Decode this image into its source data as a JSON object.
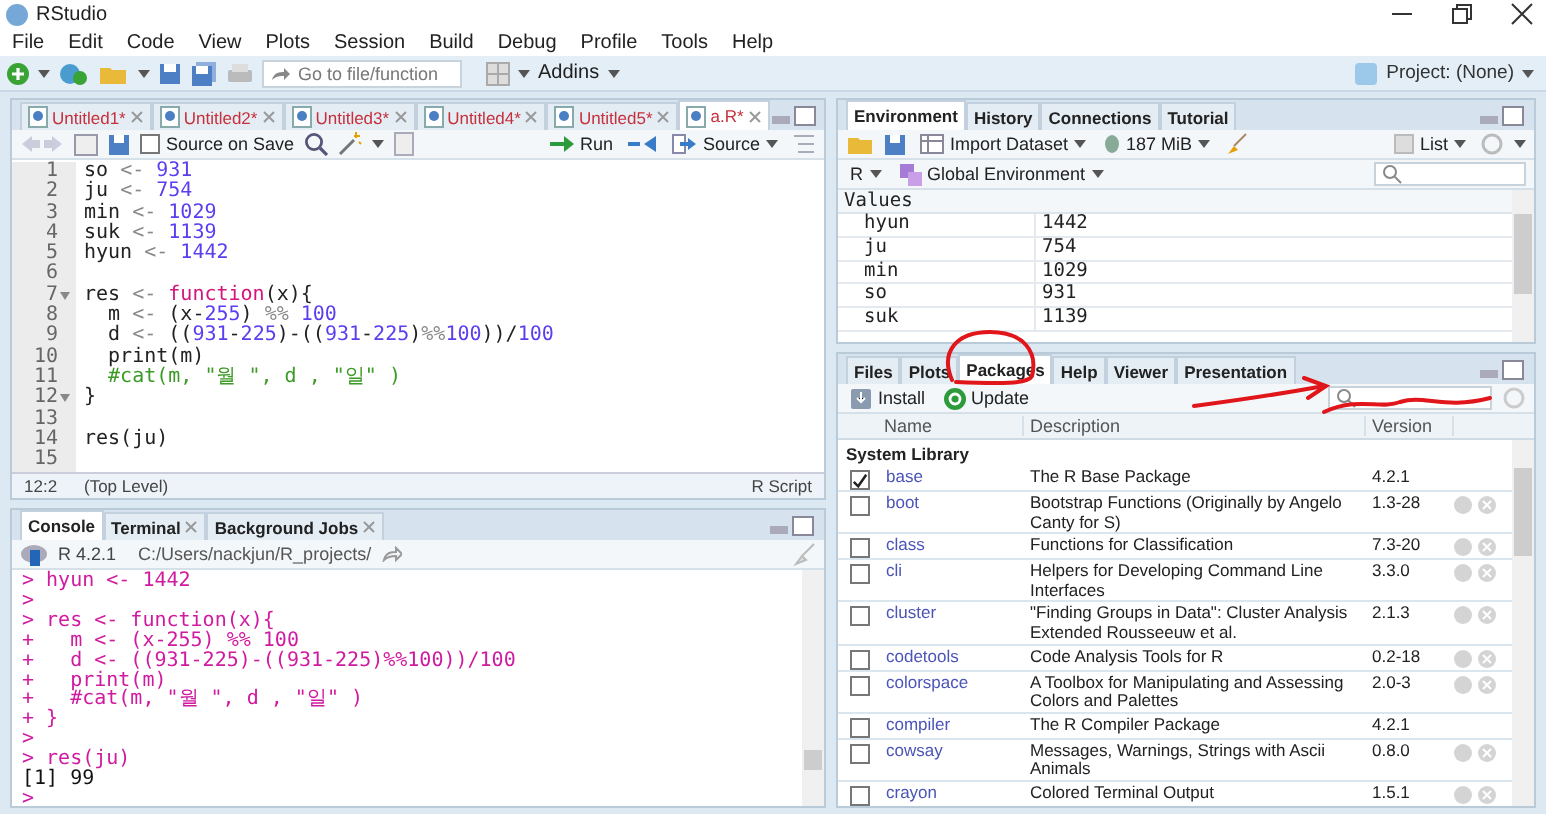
{
  "window": {
    "title": "RStudio"
  },
  "menu": [
    "File",
    "Edit",
    "Code",
    "View",
    "Plots",
    "Session",
    "Build",
    "Debug",
    "Profile",
    "Tools",
    "Help"
  ],
  "toolbar": {
    "goto_placeholder": "Go to file/function",
    "addins": "Addins",
    "project": "Project: (None)"
  },
  "editor": {
    "tabs": [
      {
        "label": "Untitled1*",
        "selected": false,
        "modified": true
      },
      {
        "label": "Untitled2*",
        "selected": false,
        "modified": true
      },
      {
        "label": "Untitled3*",
        "selected": false,
        "modified": true
      },
      {
        "label": "Untitled4*",
        "selected": false,
        "modified": true
      },
      {
        "label": "Untitled5*",
        "selected": false,
        "modified": true
      },
      {
        "label": "a.R*",
        "selected": true,
        "modified": true
      }
    ],
    "source_on_save": {
      "label": "Source on Save",
      "checked": false
    },
    "run": "Run",
    "source": "Source",
    "lines": [
      {
        "number": "1",
        "fold": false,
        "tokens": [
          {
            "kind": "plain",
            "text": "so "
          },
          {
            "kind": "op",
            "text": "<- "
          },
          {
            "kind": "number",
            "text": "931"
          }
        ]
      },
      {
        "number": "2",
        "fold": false,
        "tokens": [
          {
            "kind": "plain",
            "text": "ju "
          },
          {
            "kind": "op",
            "text": "<- "
          },
          {
            "kind": "number",
            "text": "754"
          }
        ]
      },
      {
        "number": "3",
        "fold": false,
        "tokens": [
          {
            "kind": "plain",
            "text": "min "
          },
          {
            "kind": "op",
            "text": "<- "
          },
          {
            "kind": "number",
            "text": "1029"
          }
        ]
      },
      {
        "number": "4",
        "fold": false,
        "tokens": [
          {
            "kind": "plain",
            "text": "suk "
          },
          {
            "kind": "op",
            "text": "<- "
          },
          {
            "kind": "number",
            "text": "1139"
          }
        ]
      },
      {
        "number": "5",
        "fold": false,
        "tokens": [
          {
            "kind": "plain",
            "text": "hyun "
          },
          {
            "kind": "op",
            "text": "<- "
          },
          {
            "kind": "number",
            "text": "1442"
          }
        ]
      },
      {
        "number": "6",
        "fold": false
      },
      {
        "number": "7",
        "fold": true,
        "tokens": [
          {
            "kind": "plain",
            "text": "res "
          },
          {
            "kind": "op",
            "text": "<- "
          },
          {
            "kind": "keyword",
            "text": "function"
          },
          {
            "kind": "plain",
            "text": "(x){"
          }
        ]
      },
      {
        "number": "8",
        "fold": false,
        "tokens": [
          {
            "kind": "plain",
            "text": "  m "
          },
          {
            "kind": "op",
            "text": "<- "
          },
          {
            "kind": "plain",
            "text": "(x-"
          },
          {
            "kind": "number",
            "text": "255"
          },
          {
            "kind": "plain",
            "text": ") "
          },
          {
            "kind": "op",
            "text": "%% "
          },
          {
            "kind": "number",
            "text": "100"
          }
        ]
      },
      {
        "number": "9",
        "fold": false,
        "tokens": [
          {
            "kind": "plain",
            "text": "  d "
          },
          {
            "kind": "op",
            "text": "<- "
          },
          {
            "kind": "plain",
            "text": "(("
          },
          {
            "kind": "number",
            "text": "931"
          },
          {
            "kind": "plain",
            "text": "-"
          },
          {
            "kind": "number",
            "text": "225"
          },
          {
            "kind": "plain",
            "text": ")-(("
          },
          {
            "kind": "number",
            "text": "931"
          },
          {
            "kind": "plain",
            "text": "-"
          },
          {
            "kind": "number",
            "text": "225"
          },
          {
            "kind": "plain",
            "text": ")"
          },
          {
            "kind": "op",
            "text": "%%"
          },
          {
            "kind": "number",
            "text": "100"
          },
          {
            "kind": "plain",
            "text": "))/"
          },
          {
            "kind": "number",
            "text": "100"
          }
        ]
      },
      {
        "number": "10",
        "fold": false,
        "tokens": [
          {
            "kind": "plain",
            "text": "  print(m)"
          }
        ]
      },
      {
        "number": "11",
        "fold": false,
        "tokens": [
          {
            "kind": "comment",
            "text": "  #cat(m, \"월 \", d , \"일\" )"
          }
        ]
      },
      {
        "number": "12",
        "fold": true,
        "tokens": [
          {
            "kind": "plain",
            "text": "}"
          }
        ]
      },
      {
        "number": "13",
        "fold": false
      },
      {
        "number": "14",
        "fold": false,
        "tokens": [
          {
            "kind": "plain",
            "text": "res(ju)"
          }
        ]
      },
      {
        "number": "15",
        "fold": false
      }
    ],
    "status": {
      "position": "12:2",
      "scope": "(Top Level)",
      "type": "R Script"
    }
  },
  "console": {
    "tabs": [
      {
        "label": "Console",
        "selected": true,
        "closable": false
      },
      {
        "label": "Terminal",
        "selected": false,
        "closable": true
      },
      {
        "label": "Background Jobs",
        "selected": false,
        "closable": true
      }
    ],
    "version": "R 4.2.1",
    "path": "C:/Users/nackjun/R_projects/",
    "lines": [
      {
        "kind": "input",
        "text": "> hyun <- 1442"
      },
      {
        "kind": "input",
        "text": ">"
      },
      {
        "kind": "input",
        "text": "> res <- function(x){"
      },
      {
        "kind": "input",
        "text": "+   m <- (x-255) %% 100"
      },
      {
        "kind": "input",
        "text": "+   d <- ((931-225)-((931-225)%%100))/100"
      },
      {
        "kind": "input",
        "text": "+   print(m)"
      },
      {
        "kind": "input",
        "text": "+   #cat(m, \"월 \", d , \"일\" )"
      },
      {
        "kind": "input",
        "text": "+ }"
      },
      {
        "kind": "input",
        "text": ">"
      },
      {
        "kind": "input",
        "text": "> res(ju)"
      },
      {
        "kind": "output",
        "text": "[1] 99"
      },
      {
        "kind": "input",
        "text": ">"
      }
    ]
  },
  "environment": {
    "tabs": [
      {
        "label": "Environment",
        "selected": true
      },
      {
        "label": "History",
        "selected": false
      },
      {
        "label": "Connections",
        "selected": false
      },
      {
        "label": "Tutorial",
        "selected": false
      }
    ],
    "import": "Import Dataset",
    "memory": "187 MiB",
    "view": "List",
    "language": "R",
    "scope": "Global Environment",
    "section": "Values",
    "values": [
      {
        "name": "hyun",
        "value": "1442"
      },
      {
        "name": "ju",
        "value": "754"
      },
      {
        "name": "min",
        "value": "1029"
      },
      {
        "name": "so",
        "value": "931"
      },
      {
        "name": "suk",
        "value": "1139"
      }
    ]
  },
  "packages": {
    "tabs": [
      {
        "label": "Files",
        "selected": false
      },
      {
        "label": "Plots",
        "selected": false
      },
      {
        "label": "Packages",
        "selected": true
      },
      {
        "label": "Help",
        "selected": false
      },
      {
        "label": "Viewer",
        "selected": false
      },
      {
        "label": "Presentation",
        "selected": false
      }
    ],
    "install": "Install",
    "update": "Update",
    "columns": [
      "Name",
      "Description",
      "Version"
    ],
    "section": "System Library",
    "rows": [
      {
        "name": "base",
        "description": "The R Base Package",
        "version": "4.2.1",
        "checked": true,
        "actions": false
      },
      {
        "name": "boot",
        "description": "Bootstrap Functions (Originally by Angelo Canty for S)",
        "version": "1.3-28",
        "checked": false,
        "actions": true
      },
      {
        "name": "class",
        "description": "Functions for Classification",
        "version": "7.3-20",
        "checked": false,
        "actions": true
      },
      {
        "name": "cli",
        "description": "Helpers for Developing Command Line Interfaces",
        "version": "3.3.0",
        "checked": false,
        "actions": true
      },
      {
        "name": "cluster",
        "description": "\"Finding Groups in Data\": Cluster Analysis Extended Rousseeuw et al.",
        "version": "2.1.3",
        "checked": false,
        "actions": true
      },
      {
        "name": "codetools",
        "description": "Code Analysis Tools for R",
        "version": "0.2-18",
        "checked": false,
        "actions": true
      },
      {
        "name": "colorspace",
        "description": "A Toolbox for Manipulating and Assessing Colors and Palettes",
        "version": "2.0-3",
        "checked": false,
        "actions": true
      },
      {
        "name": "compiler",
        "description": "The R Compiler Package",
        "version": "4.2.1",
        "checked": false,
        "actions": false
      },
      {
        "name": "cowsay",
        "description": "Messages, Warnings, Strings with Ascii Animals",
        "version": "0.8.0",
        "checked": false,
        "actions": true
      },
      {
        "name": "crayon",
        "description": "Colored Terminal Output",
        "version": "1.5.1",
        "checked": false,
        "actions": true
      }
    ]
  }
}
